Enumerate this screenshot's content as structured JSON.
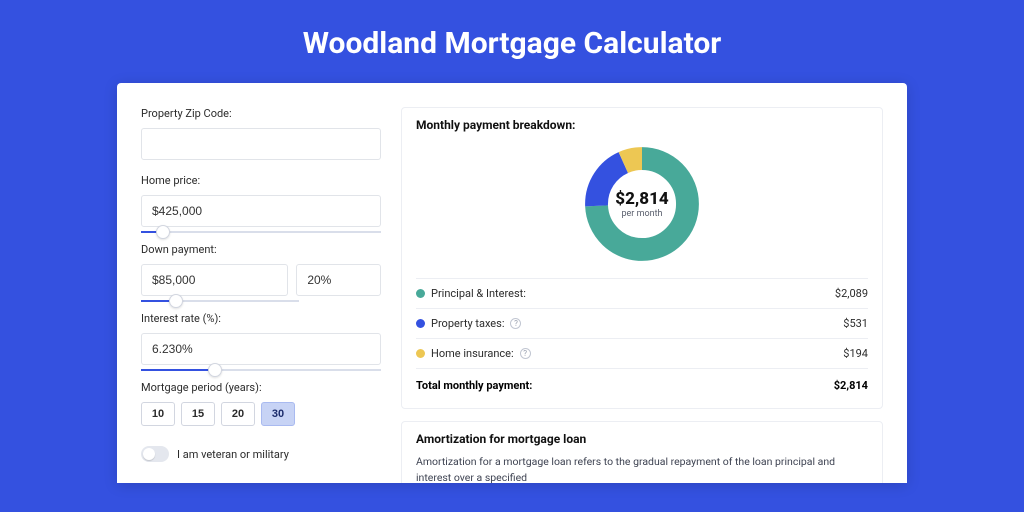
{
  "title": "Woodland Mortgage Calculator",
  "form": {
    "zip_label": "Property Zip Code:",
    "zip_value": "",
    "home_price_label": "Home price:",
    "home_price_value": "$425,000",
    "down_payment_label": "Down payment:",
    "down_payment_amount": "$85,000",
    "down_payment_pct": "20%",
    "interest_label": "Interest rate (%):",
    "interest_value": "6.230%",
    "period_label": "Mortgage period (years):",
    "period_options": [
      "10",
      "15",
      "20",
      "30"
    ],
    "period_selected": "30",
    "veteran_label": "I am veteran or military"
  },
  "breakdown": {
    "header": "Monthly payment breakdown:",
    "center_amount": "$2,814",
    "center_sub": "per month",
    "items": [
      {
        "label": "Principal & Interest:",
        "value": "$2,089",
        "color": "green",
        "help": false
      },
      {
        "label": "Property taxes:",
        "value": "$531",
        "color": "blue",
        "help": true
      },
      {
        "label": "Home insurance:",
        "value": "$194",
        "color": "yellow",
        "help": true
      }
    ],
    "total_label": "Total monthly payment:",
    "total_value": "$2,814"
  },
  "amortization": {
    "header": "Amortization for mortgage loan",
    "text": "Amortization for a mortgage loan refers to the gradual repayment of the loan principal and interest over a specified"
  },
  "chart_data": {
    "type": "pie",
    "title": "Monthly payment breakdown",
    "series": [
      {
        "name": "Principal & Interest",
        "value": 2089,
        "color": "#48a999"
      },
      {
        "name": "Property taxes",
        "value": 531,
        "color": "#3451e0"
      },
      {
        "name": "Home insurance",
        "value": 194,
        "color": "#edc753"
      }
    ],
    "total": 2814,
    "total_label": "per month"
  }
}
